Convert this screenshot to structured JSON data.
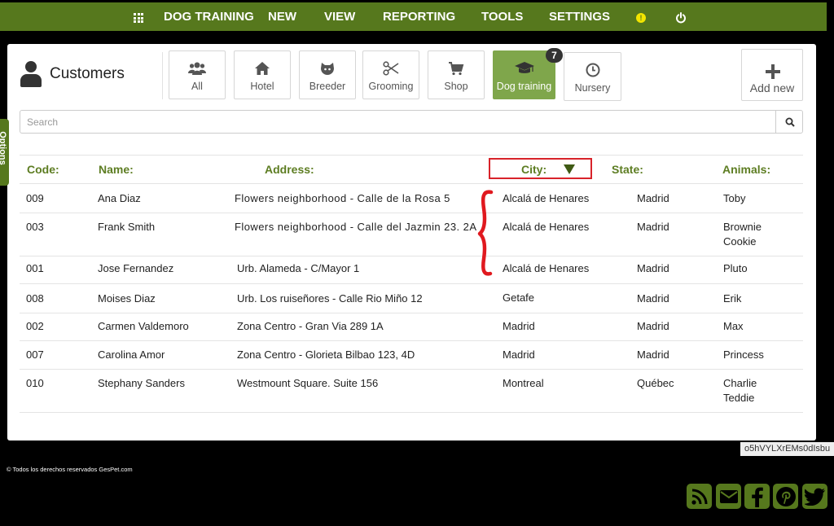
{
  "nav": {
    "items": [
      "DOG TRAINING",
      "NEW",
      "VIEW",
      "REPORTING",
      "TOOLS",
      "SETTINGS"
    ],
    "warning_glyph": "!"
  },
  "side_tab": {
    "label": "Options"
  },
  "header": {
    "title": "Customers"
  },
  "filters": [
    {
      "label": "All",
      "icon": "users-icon"
    },
    {
      "label": "Hotel",
      "icon": "home-icon"
    },
    {
      "label": "Breeder",
      "icon": "dog-icon"
    },
    {
      "label": "Grooming",
      "icon": "scissors-icon"
    },
    {
      "label": "Shop",
      "icon": "cart-icon"
    },
    {
      "label": "Dog training",
      "icon": "graduation-cap-icon",
      "active": true,
      "badge": "7"
    },
    {
      "label": "Nursery",
      "icon": "clock-icon"
    }
  ],
  "add_button": {
    "label": "Add new"
  },
  "search": {
    "placeholder": "Search"
  },
  "table": {
    "columns": [
      "Code:",
      "Name:",
      "Address:",
      "City:",
      "State:",
      "Animals:"
    ],
    "rows": [
      {
        "code": "009",
        "name": "Ana Diaz",
        "address": "Flowers neighborhood - Calle de la Rosa 5",
        "city": "Alcalá de Henares",
        "state": "Madrid",
        "animals": [
          "Toby"
        ]
      },
      {
        "code": "003",
        "name": "Frank Smith",
        "address": "Flowers neighborhood - Calle del Jazmin 23. 2A",
        "city": "Alcalá de Henares",
        "state": "Madrid",
        "animals": [
          "Brownie",
          "Cookie"
        ]
      },
      {
        "code": "001",
        "name": "Jose Fernandez",
        "address": "Urb. Alameda - C/Mayor 1",
        "city": "Alcalá de Henares",
        "state": "Madrid",
        "animals": [
          "Pluto"
        ]
      },
      {
        "code": "008",
        "name": "Moises Diaz",
        "address": "Urb. Los ruiseñores - Calle Rio Miño 12",
        "city": "Getafe",
        "state": "Madrid",
        "animals": [
          "Erik"
        ]
      },
      {
        "code": "002",
        "name": "Carmen Valdemoro",
        "address": "Zona Centro - Gran Via 289 1A",
        "city": "Madrid",
        "state": "Madrid",
        "animals": [
          "Max"
        ]
      },
      {
        "code": "007",
        "name": "Carolina Amor",
        "address": "Zona Centro - Glorieta Bilbao 123, 4D",
        "city": "Madrid",
        "state": "Madrid",
        "animals": [
          "Princess"
        ]
      },
      {
        "code": "010",
        "name": "Stephany Sanders",
        "address": "Westmount Square. Suite 156",
        "city": "Montreal",
        "state": "Québec",
        "animals": [
          "Charlie",
          "Teddie"
        ]
      }
    ]
  },
  "footer": {
    "copyright": "©   Todos los derechos reservados GesPet.com",
    "hash": "o5hVYLXrEMs0dIsbu"
  },
  "social": [
    "rss-icon",
    "mail-icon",
    "facebook-icon",
    "pinterest-icon",
    "twitter-icon"
  ],
  "colors": {
    "brand_green": "#56781d",
    "active_green": "#7fa64b",
    "header_text": "#5d7d22",
    "annotation_red": "#d8232a"
  }
}
